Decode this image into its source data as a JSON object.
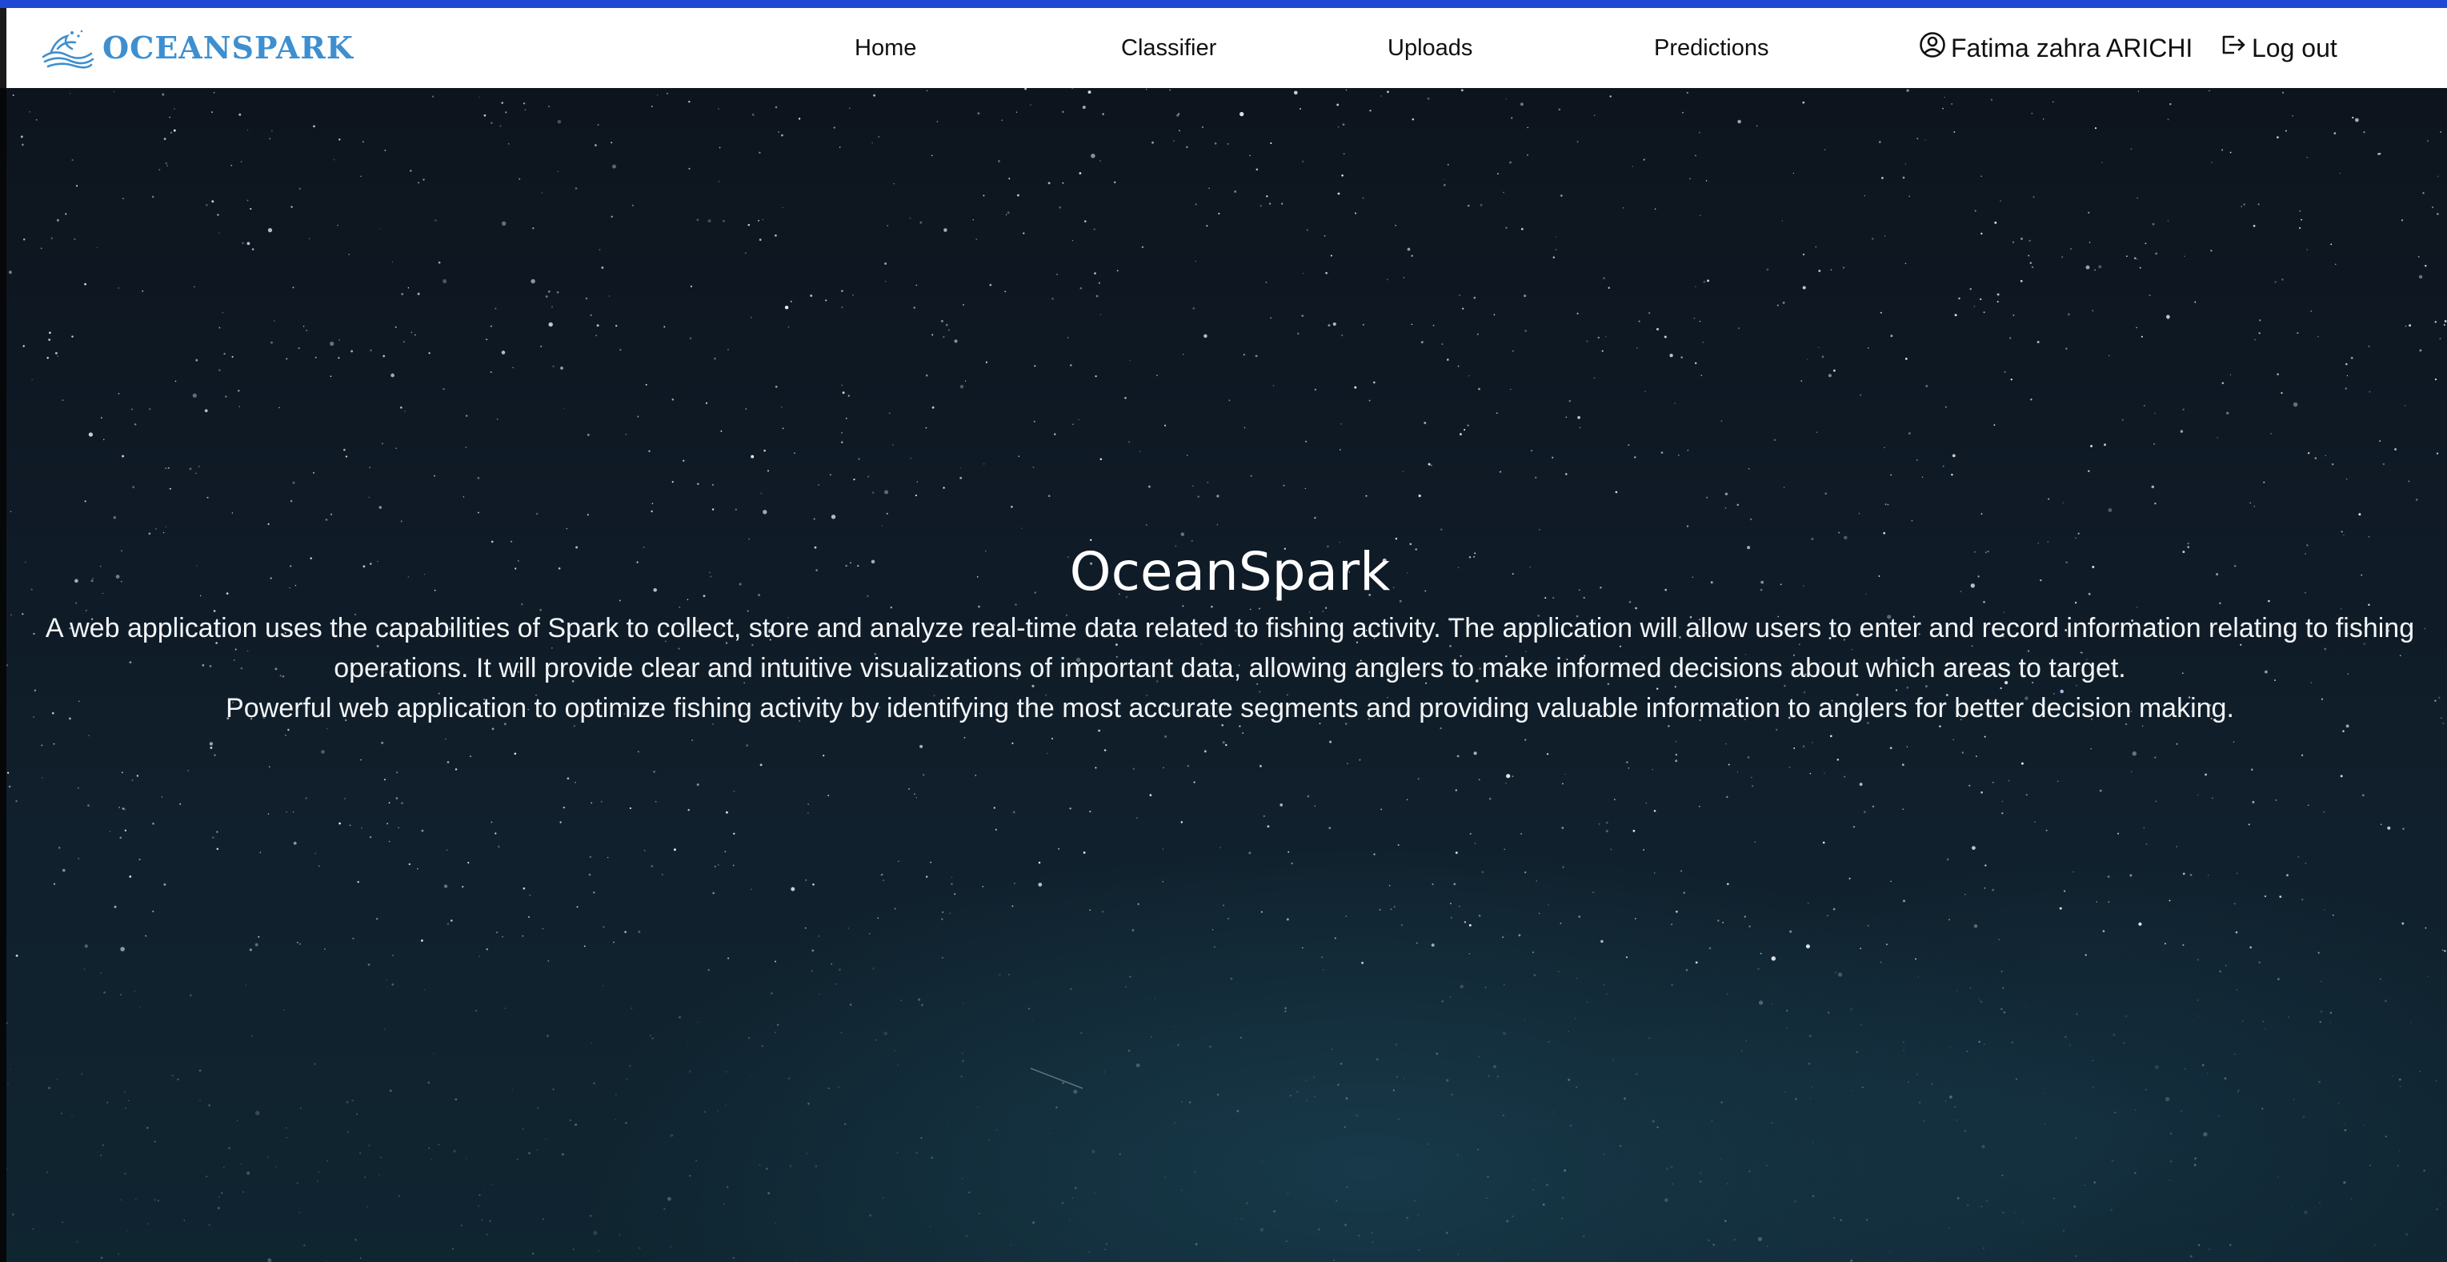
{
  "navbar": {
    "brand_name": "OCEANSPARK",
    "brand_color": "#3d8fd0",
    "accent_stripe_color": "#1f48d6",
    "links": [
      {
        "label": "Home"
      },
      {
        "label": "Classifier"
      },
      {
        "label": "Uploads"
      },
      {
        "label": "Predictions"
      }
    ],
    "user": {
      "name": "Fatima zahra ARICHI",
      "icon": "user-circle-icon"
    },
    "logout": {
      "label": "Log out",
      "icon": "logout-icon"
    }
  },
  "hero": {
    "title": "OceanSpark",
    "paragraph_1": "A web application uses the capabilities of Spark to collect, store and analyze real-time data related to fishing activity. The application will allow users to enter and record information relating to fishing operations. It will provide clear and intuitive visualizations of important data, allowing anglers to make informed decisions about which areas to target.",
    "paragraph_2": "Powerful web application to optimize fishing activity by identifying the most accurate segments and providing valuable information to anglers for better decision making.",
    "background": "starry night sky"
  }
}
